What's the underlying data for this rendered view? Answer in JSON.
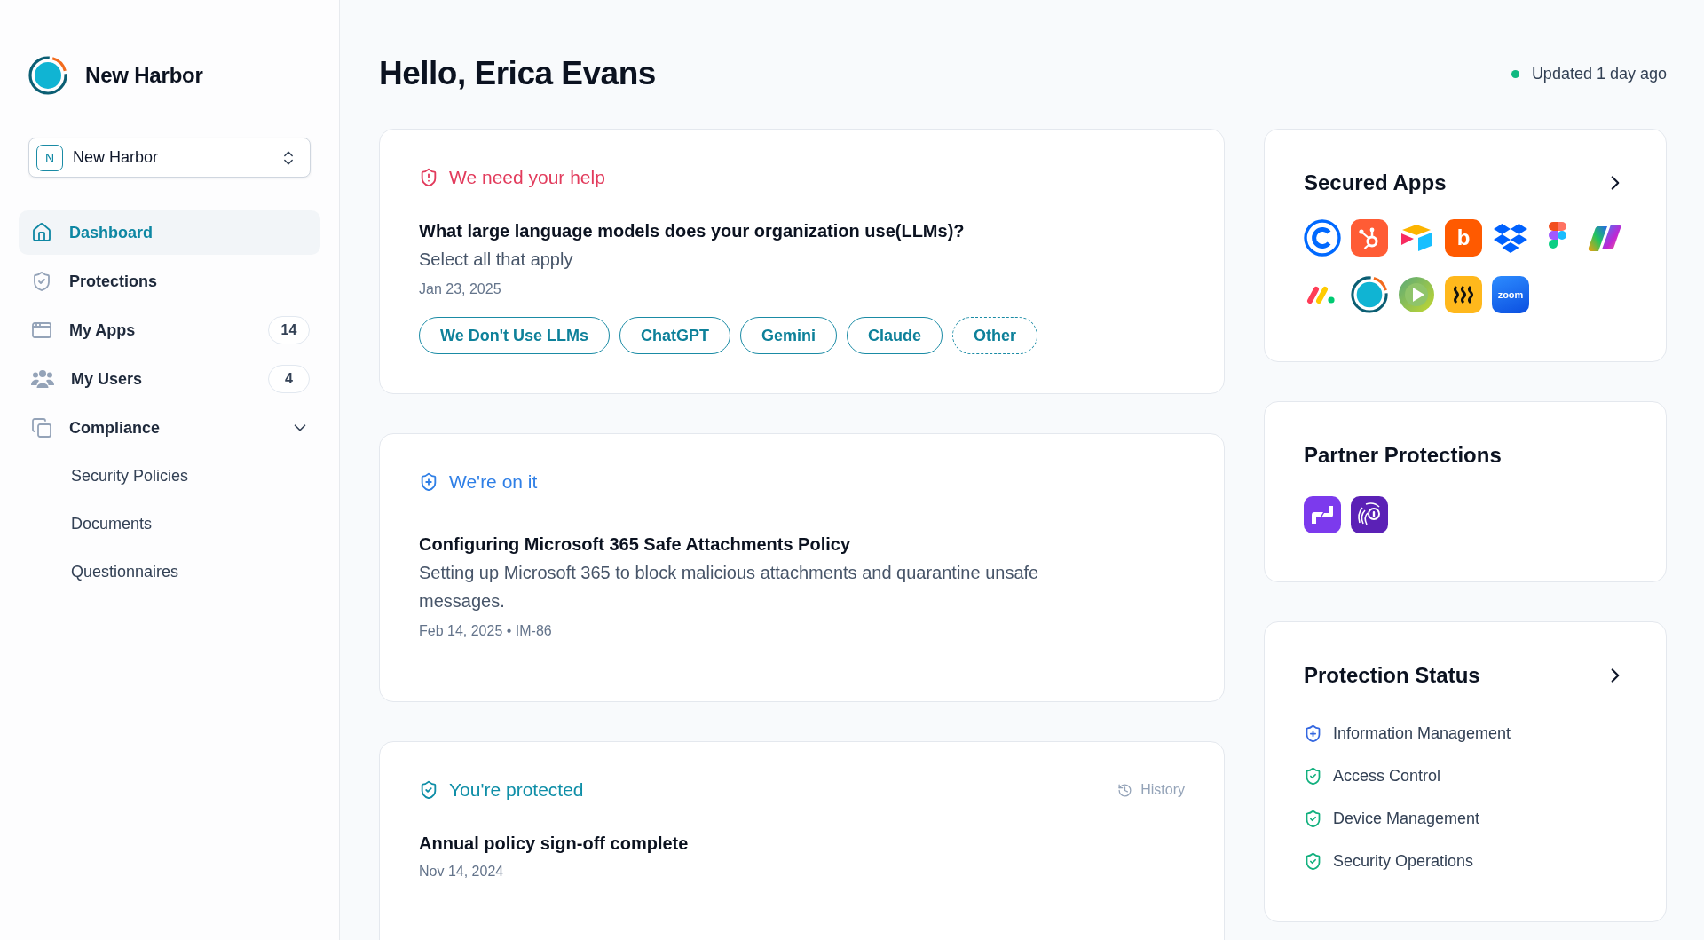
{
  "sidebar": {
    "brand": "New Harbor",
    "workspace": {
      "initial": "N",
      "name": "New Harbor"
    },
    "nav": [
      {
        "label": "Dashboard",
        "selected": true
      },
      {
        "label": "Protections",
        "selected": false
      },
      {
        "label": "My Apps",
        "selected": false,
        "count": "14"
      },
      {
        "label": "My Users",
        "selected": false,
        "count": "4"
      },
      {
        "label": "Compliance",
        "selected": false,
        "expanded": true,
        "children": [
          {
            "label": "Security Policies",
            "selected": false
          },
          {
            "label": "Documents",
            "selected": false
          },
          {
            "label": "Questionnaires",
            "selected": false
          }
        ]
      }
    ]
  },
  "header": {
    "greeting": "Hello, Erica Evans",
    "updated": "Updated 1 day ago"
  },
  "feed": [
    {
      "kind": "help",
      "heading": "We need your help",
      "title": "What large language models does your organization use(LLMs)?",
      "subtitle": "Select all that apply",
      "meta": "Jan 23, 2025",
      "options": [
        {
          "label": "We Don't Use LLMs",
          "kind": "choice"
        },
        {
          "label": "ChatGPT",
          "kind": "choice"
        },
        {
          "label": "Gemini",
          "kind": "choice"
        },
        {
          "label": "Claude",
          "kind": "choice"
        },
        {
          "label": "Other",
          "kind": "custom"
        }
      ]
    },
    {
      "kind": "working",
      "heading": "We're on it",
      "title": "Configuring Microsoft 365 Safe Attachments Policy",
      "subtitle": "Setting up Microsoft 365 to block malicious attachments and quarantine unsafe messages.",
      "meta": "Feb 14, 2025 • IM-86"
    },
    {
      "kind": "protected",
      "heading": "You're protected",
      "link": "History",
      "title": "Annual policy sign-off complete",
      "meta": "Nov 14, 2024"
    }
  ],
  "secured_apps": {
    "title": "Secured Apps",
    "apps": [
      {
        "kind": "c-ring"
      },
      {
        "kind": "hub"
      },
      {
        "kind": "cube"
      },
      {
        "kind": "letter-tile",
        "text": "b"
      },
      {
        "kind": "box-stack"
      },
      {
        "kind": "shapes"
      },
      {
        "kind": "ribbon"
      },
      {
        "kind": "marks"
      },
      {
        "kind": "ring"
      },
      {
        "kind": "play"
      },
      {
        "kind": "waves"
      },
      {
        "kind": "word-tile",
        "text": "zoom"
      }
    ]
  },
  "partner_protections": {
    "title": "Partner Protections",
    "partners": [
      {
        "kind": "link-mark"
      },
      {
        "kind": "fingerprint-lock"
      }
    ]
  },
  "protection_status": {
    "title": "Protection Status",
    "items": [
      {
        "label": "Information Management",
        "kind": "in-progress"
      },
      {
        "label": "Access Control",
        "kind": "protected"
      },
      {
        "label": "Device Management",
        "kind": "protected"
      },
      {
        "label": "Security Operations",
        "kind": "protected"
      }
    ]
  }
}
